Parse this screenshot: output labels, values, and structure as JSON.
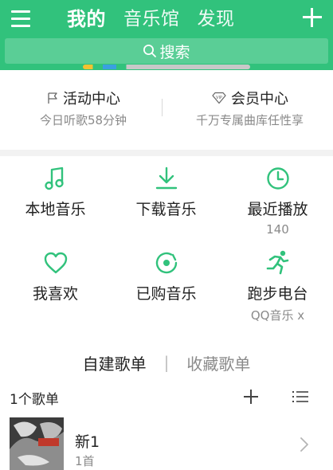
{
  "topbar": {
    "tabs": [
      {
        "label": "我的",
        "active": true
      },
      {
        "label": "音乐馆",
        "active": false
      },
      {
        "label": "发现",
        "active": false
      }
    ],
    "search_label": "搜索",
    "accent": "#31c27c"
  },
  "center": {
    "activity": {
      "title": "活动中心",
      "subtitle": "今日听歌58分钟"
    },
    "vip": {
      "title": "会员中心",
      "subtitle": "千万专属曲库任性享"
    }
  },
  "grid": {
    "local": {
      "label": "本地音乐",
      "icon": "music-note-icon"
    },
    "download": {
      "label": "下载音乐",
      "icon": "download-icon"
    },
    "recent": {
      "label": "最近播放",
      "sub": "140",
      "icon": "clock-icon"
    },
    "favorite": {
      "label": "我喜欢",
      "icon": "heart-icon"
    },
    "purchased": {
      "label": "已购音乐",
      "icon": "disc-icon"
    },
    "running": {
      "label": "跑步电台",
      "sub": "QQ音乐 x",
      "icon": "runner-icon"
    }
  },
  "playlists": {
    "tabs": {
      "own": "自建歌单",
      "separator": "|",
      "collected": "收藏歌单"
    },
    "count_label": "1个歌单",
    "items": [
      {
        "name": "新1",
        "meta": "1首"
      }
    ]
  }
}
